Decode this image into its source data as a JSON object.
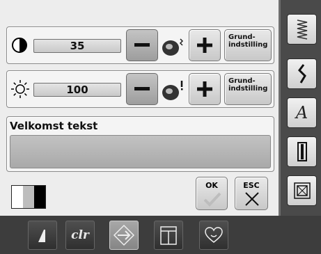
{
  "contrast": {
    "value": "35",
    "minus_icon": "minus",
    "plus_icon": "plus",
    "default_label": "Grund-\nindstilling"
  },
  "brightness": {
    "value": "100",
    "minus_icon": "minus",
    "plus_icon": "plus",
    "default_label": "Grund-\nindstilling"
  },
  "welcome": {
    "title": "Velkomst tekst",
    "text": ""
  },
  "dialog": {
    "ok_label": "OK",
    "esc_label": "ESC"
  },
  "sidebar": {
    "items": [
      "stitch-pattern-icon",
      "stitch-icon",
      "alphabet-icon",
      "buttonhole-icon",
      "quilt-icon",
      "setup-icon"
    ],
    "alphabet_glyph": "A"
  },
  "toolbar": {
    "clr_label": "clr",
    "items": [
      "presser-foot-icon",
      "clear-icon",
      "arrow-icon",
      "memory-icon",
      "favorite-icon"
    ]
  },
  "colors": {
    "panel": "#ededed",
    "frame": "#4a4a4a",
    "selected": "#8a8a8a"
  }
}
